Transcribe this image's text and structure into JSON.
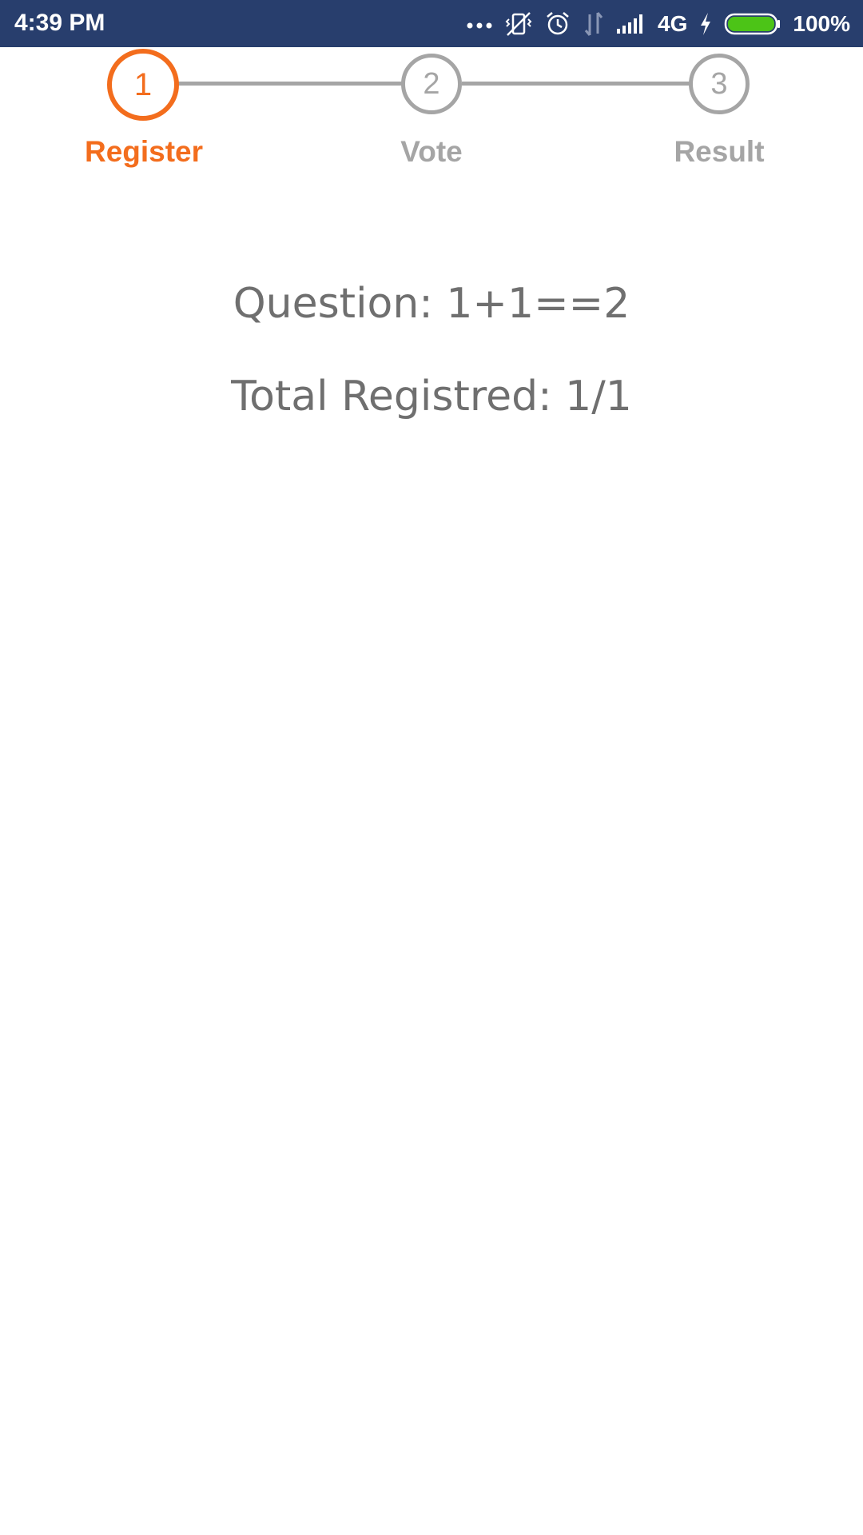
{
  "status_bar": {
    "time": "4:39 PM",
    "network": "4G",
    "battery_percent": "100%",
    "battery_level": 1.0,
    "icons": [
      "more-dots-icon",
      "vibrate-mute-icon",
      "alarm-icon",
      "data-transfer-icon",
      "signal-icon",
      "charging-icon",
      "battery-icon"
    ],
    "colors": {
      "background": "#283e6d",
      "battery_fill": "#4cc417"
    }
  },
  "stepper": {
    "steps": [
      {
        "number": "1",
        "label": "Register",
        "state": "active"
      },
      {
        "number": "2",
        "label": "Vote",
        "state": "inactive"
      },
      {
        "number": "3",
        "label": "Result",
        "state": "inactive"
      }
    ],
    "colors": {
      "active": "#f36d1d",
      "inactive": "#a5a5a5"
    }
  },
  "main": {
    "question": "Question: 1+1==2",
    "total_registered": "Total Registred: 1/1"
  }
}
